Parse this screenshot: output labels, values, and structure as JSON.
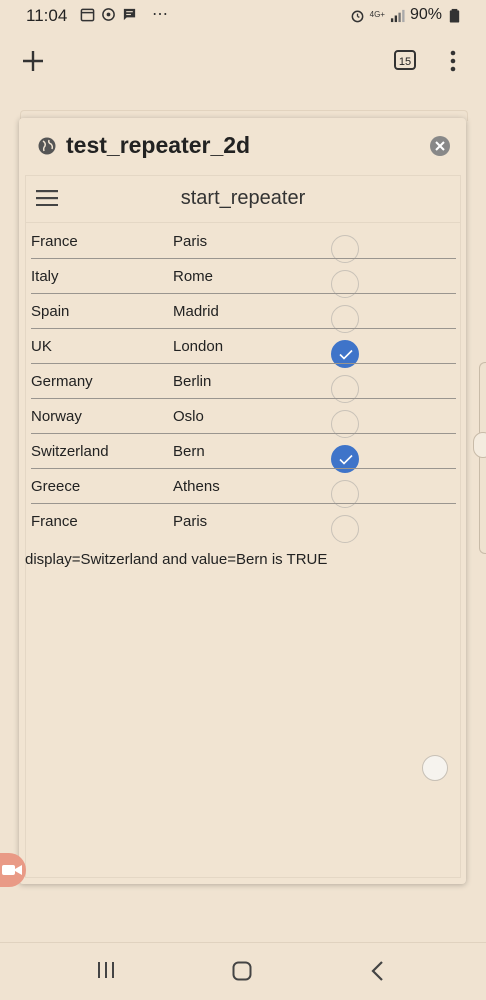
{
  "status_bar": {
    "time": "11:04",
    "dots": "⋯",
    "network": "4G+",
    "battery": "90%"
  },
  "toolbar": {
    "tab_count": "15"
  },
  "card": {
    "title": "test_repeater_2d",
    "inner_title": "start_repeater"
  },
  "rows": [
    {
      "display": "France",
      "value": "Paris",
      "checked": false
    },
    {
      "display": "Italy",
      "value": "Rome",
      "checked": false
    },
    {
      "display": "Spain",
      "value": "Madrid",
      "checked": false
    },
    {
      "display": "UK",
      "value": "London",
      "checked": true
    },
    {
      "display": "Germany",
      "value": "Berlin",
      "checked": false
    },
    {
      "display": "Norway",
      "value": "Oslo",
      "checked": false
    },
    {
      "display": "Switzerland",
      "value": "Bern",
      "checked": true
    },
    {
      "display": "Greece",
      "value": "Athens",
      "checked": false
    },
    {
      "display": "France",
      "value": "Paris",
      "checked": false
    }
  ],
  "result_text": "display=Switzerland and value=Bern is TRUE",
  "colors": {
    "background": "#f0e3d1",
    "checked": "#3f74c9",
    "camera_button": "#e99a86"
  },
  "icons": {
    "add": "plus-icon",
    "tabs": "tabs-icon",
    "menu": "more-vert-icon",
    "globe": "globe-icon",
    "close": "close-icon",
    "hamburger": "hamburger-icon",
    "check": "checkmark-icon"
  }
}
